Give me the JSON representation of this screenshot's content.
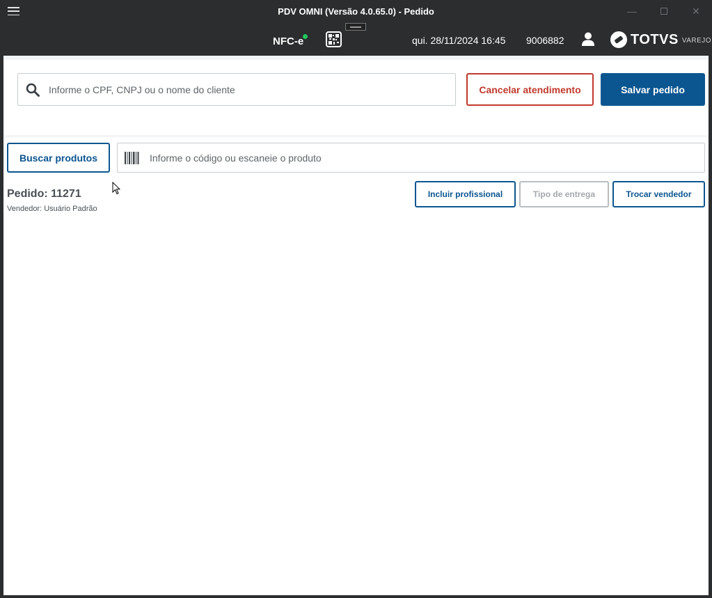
{
  "window": {
    "title": "PDV OMNI (Versão 4.0.65.0) - Pedido",
    "controls": [
      "minimize",
      "maximize",
      "close"
    ]
  },
  "header": {
    "nfce_label": "NFC-e",
    "nfce_status_color": "#22c55e",
    "datetime": "qui. 28/11/2024 16:45",
    "terminal_id": "9006882",
    "brand": "TOTVS",
    "brand_sub": "VAREJO"
  },
  "client": {
    "search_placeholder": "Informe o CPF, CNPJ ou o nome do cliente",
    "search_value": "",
    "cancel_label": "Cancelar atendimento",
    "save_label": "Salvar pedido"
  },
  "products": {
    "search_button_label": "Buscar produtos",
    "code_placeholder": "Informe o código ou escaneie o produto",
    "code_value": ""
  },
  "order": {
    "title": "Pedido: 11271",
    "seller": "Vendedor: Usuário Padrão",
    "actions": {
      "add_professional": "Incluir profissional",
      "delivery_type": "Tipo de entrega",
      "change_seller": "Trocar vendedor"
    }
  },
  "colors": {
    "primary": "#0b5690",
    "danger": "#c0392b",
    "header_bg": "#2b2d2f",
    "disabled": "#a4a8ad"
  },
  "icons": [
    "menu-icon",
    "qr-code-icon",
    "user-icon",
    "search-icon",
    "barcode-icon",
    "totvs-logo-icon"
  ]
}
